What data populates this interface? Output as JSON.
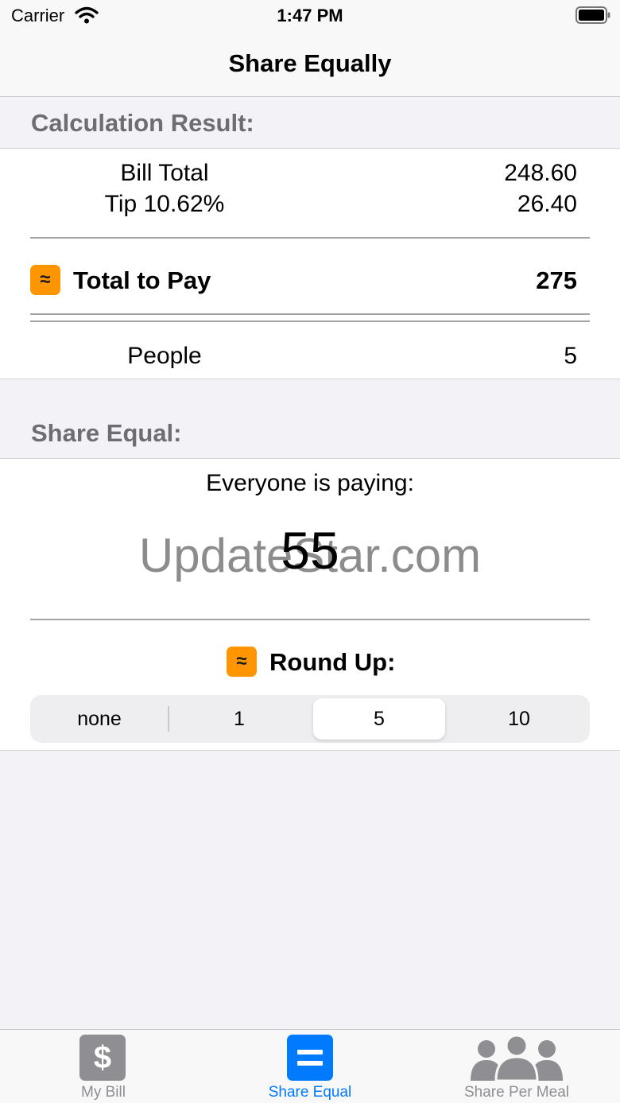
{
  "status_bar": {
    "carrier": "Carrier",
    "time": "1:47 PM"
  },
  "nav": {
    "title": "Share Equally"
  },
  "calc": {
    "header": "Calculation Result:",
    "bill_total_label": "Bill Total",
    "bill_total_value": "248.60",
    "tip_label": "Tip 10.62%",
    "tip_value": "26.40",
    "approx_symbol": "≈",
    "total_label": "Total to Pay",
    "total_value": "275",
    "people_label": "People",
    "people_value": "5"
  },
  "share": {
    "header": "Share Equal:",
    "paying_label": "Everyone is paying:",
    "amount": "55",
    "round_up_label": "Round Up:",
    "segments": [
      "none",
      "1",
      "5",
      "10"
    ],
    "selected_segment": "5"
  },
  "watermark": "UpdateStar.com",
  "tabs": [
    {
      "label": "My Bill",
      "icon": "dollar-icon",
      "glyph": "$",
      "active": false
    },
    {
      "label": "Share Equal",
      "icon": "equals-icon",
      "active": true
    },
    {
      "label": "Share Per Meal",
      "icon": "people-icon",
      "active": false
    }
  ],
  "colors": {
    "accent": "#007aff",
    "badge": "#ff9500",
    "inactive_tab": "#8e8e93",
    "section_header": "#6d6d72",
    "background": "#f2f2f7"
  }
}
